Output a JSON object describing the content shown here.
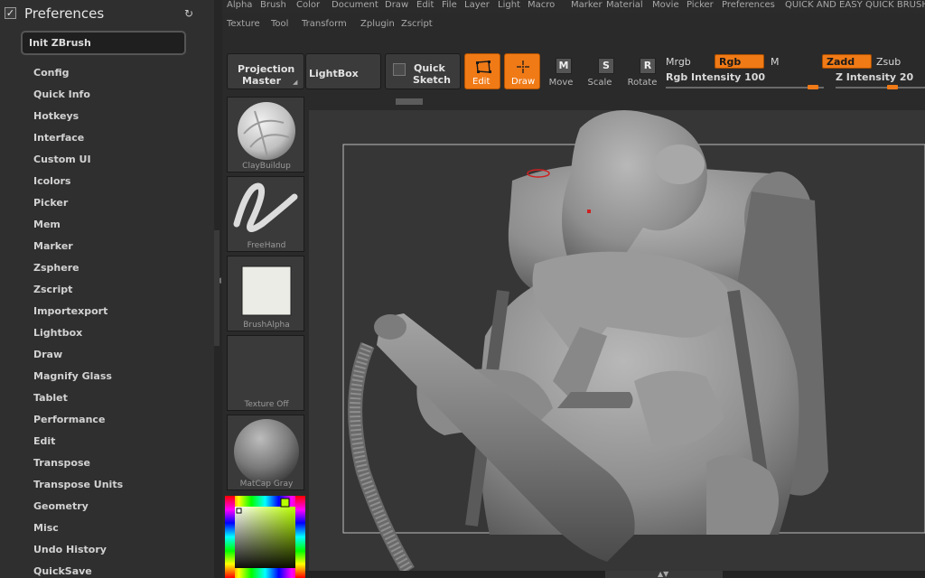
{
  "preferences": {
    "title": "Preferences",
    "init_button": "Init ZBrush",
    "items": [
      "Config",
      "Quick Info",
      "Hotkeys",
      "Interface",
      "Custom UI",
      "Icolors",
      "Picker",
      "Mem",
      "Marker",
      "Zsphere",
      "Zscript",
      "Importexport",
      "Lightbox",
      "Draw",
      "Magnify Glass",
      "Tablet",
      "Performance",
      "Edit",
      "Transpose",
      "Transpose Units",
      "Geometry",
      "Misc",
      "Undo History",
      "QuickSave"
    ]
  },
  "menu": {
    "row1": [
      "Alpha",
      "Brush",
      "Color",
      "Document",
      "Draw",
      "Edit",
      "File",
      "Layer",
      "Light",
      "Macro",
      "Marker",
      "Material",
      "Movie",
      "Picker",
      "Preferences",
      "QUICK AND EASY",
      "QUICK BRUSHE"
    ],
    "row2": [
      "Texture",
      "Tool",
      "Transform",
      "Zplugin",
      "Zscript"
    ]
  },
  "toolbar": {
    "projection_master": [
      "Projection",
      "Master"
    ],
    "lightbox": "LightBox",
    "quick_sketch": [
      "Quick",
      "Sketch"
    ],
    "edit": "Edit",
    "draw": "Draw",
    "move": "Move",
    "scale": "Scale",
    "rotate": "Rotate",
    "mrgb": "Mrgb",
    "rgb": "Rgb",
    "m": "M",
    "zadd": "Zadd",
    "zsub": "Zsub",
    "rgb_intensity": "Rgb Intensity 100",
    "z_intensity": "Z Intensity 20",
    "rgb_intensity_value": 100,
    "z_intensity_value": 20,
    "accent_color": "#f07a16"
  },
  "shelf": {
    "brush": "ClayBuildup",
    "stroke": "FreeHand",
    "alpha": "BrushAlpha",
    "texture": "Texture Off",
    "material": "MatCap Gray"
  }
}
